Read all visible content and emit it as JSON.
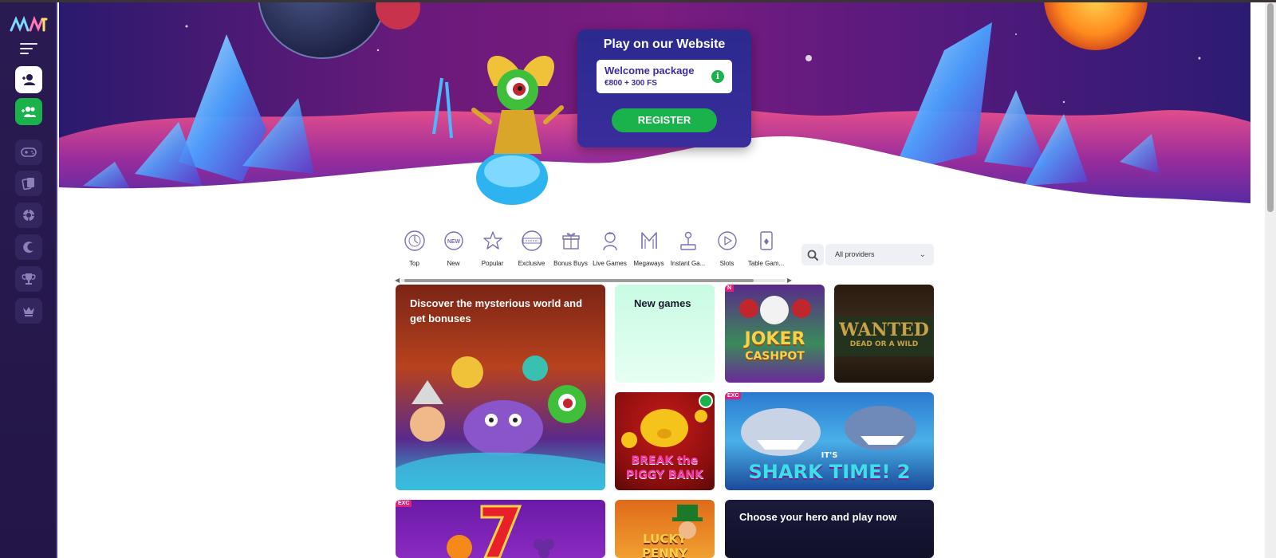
{
  "brand": {
    "logo_text": "MF"
  },
  "sidebar": {
    "menu_icon": "hamburger-icon",
    "login_icon": "user-icon",
    "register_icon": "users-plus-icon",
    "nav_icons": [
      "gamepad-icon",
      "cards-icon",
      "chip-icon",
      "crescent-icon",
      "trophy-icon",
      "crown-icon"
    ]
  },
  "promo": {
    "title": "Play on our Website",
    "welcome_title": "Welcome package",
    "welcome_amount": "€800 + 300 FS",
    "info": "i",
    "register_label": "REGISTER"
  },
  "categories": [
    {
      "label": "Top",
      "icon": "top-icon"
    },
    {
      "label": "New",
      "icon": "new-icon"
    },
    {
      "label": "Popular",
      "icon": "star-icon"
    },
    {
      "label": "Exclusive",
      "icon": "exclusive-icon"
    },
    {
      "label": "Bonus Buys",
      "icon": "gift-icon"
    },
    {
      "label": "Live Games",
      "icon": "dealer-icon"
    },
    {
      "label": "Megaways",
      "icon": "megaways-icon"
    },
    {
      "label": "Instant Ga...",
      "icon": "joystick-icon"
    },
    {
      "label": "Slots",
      "icon": "play-icon"
    },
    {
      "label": "Table Gam...",
      "icon": "playing-card-icon"
    }
  ],
  "filter": {
    "providers_value": "All providers"
  },
  "tiles": {
    "discover_title": "Discover the mysterious world and get bonuses",
    "new_games_title": "New games",
    "joker_line1": "JOKER",
    "joker_line2": "CASHPOT",
    "wanted_line1": "WANTED",
    "wanted_line2": "DEAD OR A WILD",
    "piggy_line1": "BREAK the",
    "piggy_line2": "PIGGY BANK",
    "shark_line1": "IT'S",
    "shark_line2": "SHARK TIME! 2",
    "lucky_line1": "LUCKY",
    "lucky_line2": "PENNY",
    "hero_title": "Choose your hero and play now",
    "badge_new": "N",
    "badge_exclusive": "EXC",
    "badge_exclusive2": "EXC"
  }
}
